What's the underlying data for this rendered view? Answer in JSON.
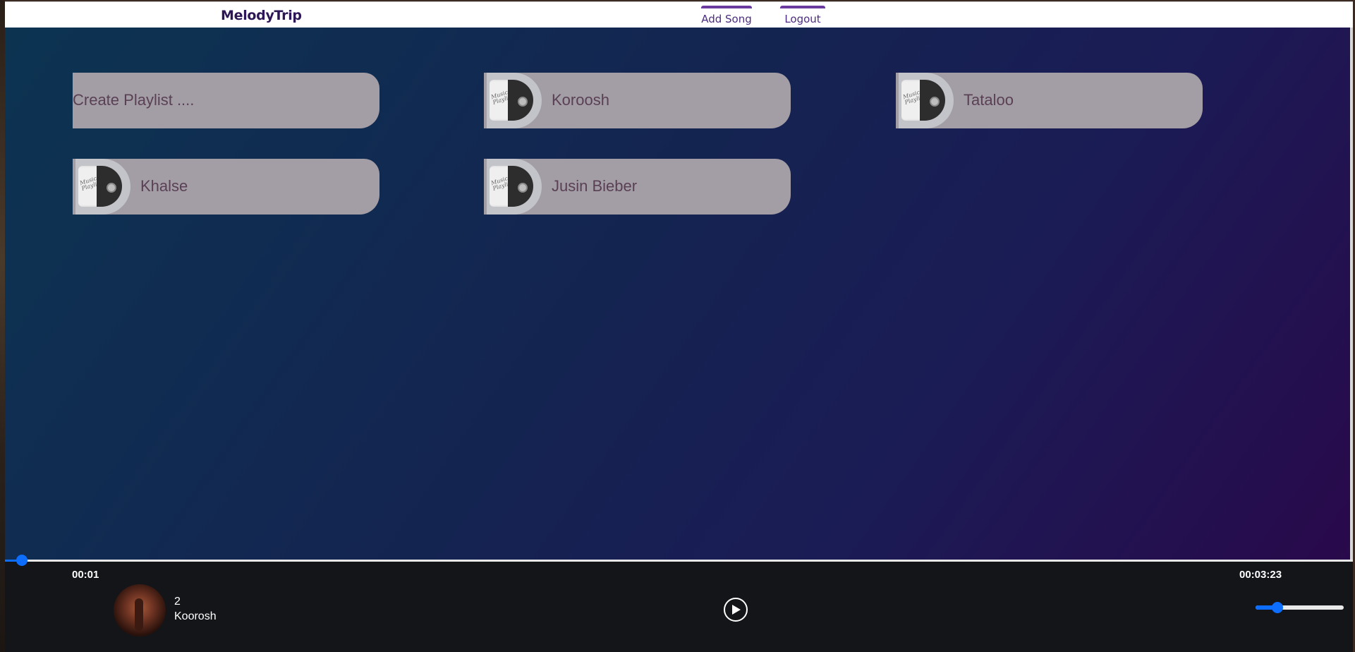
{
  "header": {
    "brand": "MelodyTrip",
    "nav": {
      "add_song": "Add Song",
      "logout": "Logout"
    }
  },
  "playlists": {
    "create_label": "Create Playlist ....",
    "thumbnail_caption": "Music Playlist",
    "items": [
      "Koroosh",
      "Tataloo",
      "Khalse",
      "Jusin Bieber"
    ]
  },
  "player": {
    "current_time": "00:01",
    "total_time": "00:03:23",
    "progress": 0.005,
    "track_title": "2",
    "track_artist": "Koorosh",
    "play_icon": "play-icon",
    "volume": 0.25
  },
  "colors": {
    "accent": "#0d6efd",
    "brand": "#2d1655",
    "nav_accent": "#6a3a9e",
    "card_bg": "#a39ea5",
    "card_text": "#5a4055",
    "background_start": "#0c3451",
    "background_end": "#29094b"
  }
}
